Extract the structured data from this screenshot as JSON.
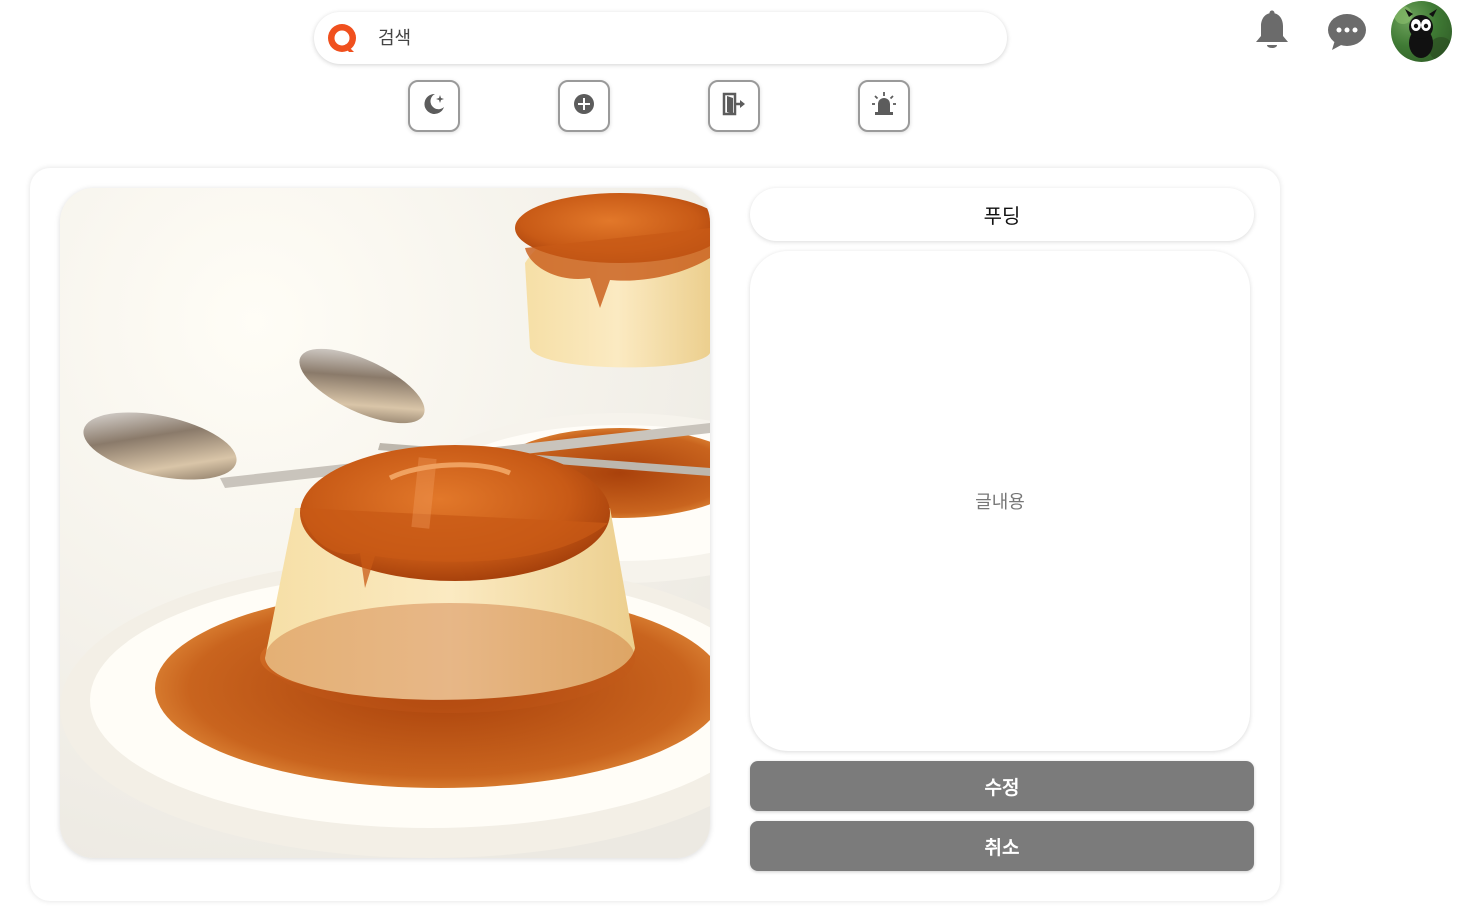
{
  "search": {
    "placeholder": "검색"
  },
  "post": {
    "title": "푸딩",
    "content": "글내용",
    "image": "pudding-photo"
  },
  "actions": {
    "edit_label": "수정",
    "cancel_label": "취소"
  },
  "icons": {
    "logo": "app-logo-icon",
    "toolbar": [
      "dark-mode-icon",
      "add-icon",
      "logout-icon",
      "report-siren-icon"
    ],
    "header": [
      "bell-icon",
      "chat-icon",
      "avatar"
    ]
  },
  "colors": {
    "brand": "#f0501e",
    "button": "#7b7b7b",
    "icon": "#6b6b6b"
  }
}
